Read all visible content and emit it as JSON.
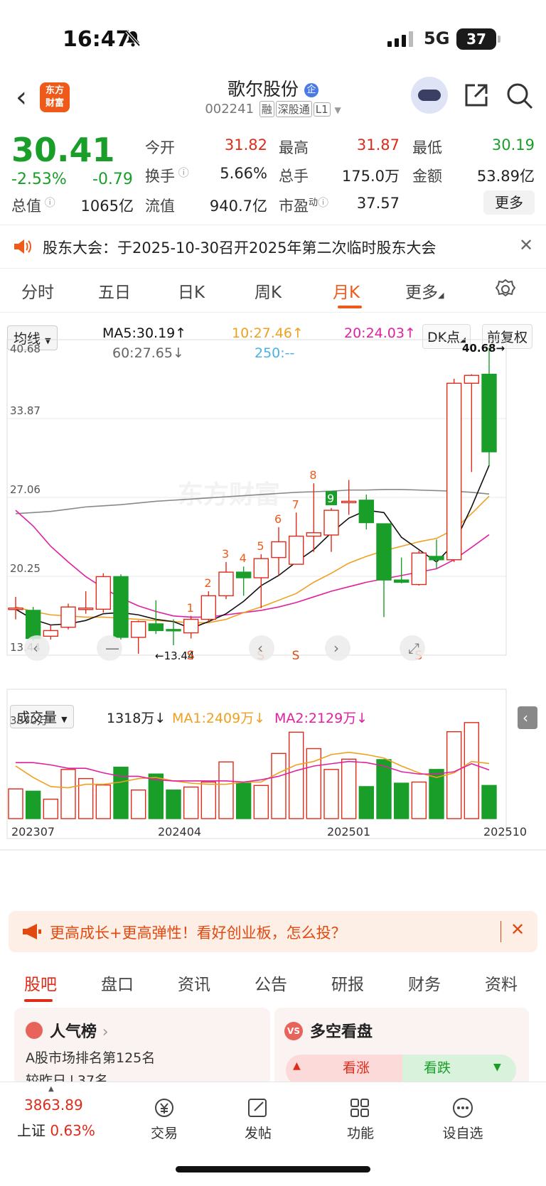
{
  "status_bar": {
    "time": "16:47",
    "network": "5G",
    "battery": "37"
  },
  "header": {
    "logo_text": "东方财富",
    "stock_name": "歌尔股份",
    "stock_code": "002241",
    "tags": [
      "融",
      "深股通",
      "L1"
    ]
  },
  "quote": {
    "price": "30.41",
    "change_pct": "-2.53%",
    "change_amt": "-0.79",
    "fields": [
      {
        "label": "今开",
        "value": "31.82",
        "color": "#e02a1a"
      },
      {
        "label": "最高",
        "value": "31.87",
        "color": "#e02a1a"
      },
      {
        "label": "最低",
        "value": "30.19",
        "color": "#1a9e2a"
      },
      {
        "label": "换手",
        "value": "5.66%",
        "color": "#222222"
      },
      {
        "label": "总手",
        "value": "175.0万",
        "color": "#222222"
      },
      {
        "label": "金额",
        "value": "53.89亿",
        "color": "#222222"
      },
      {
        "label": "总值",
        "value": "1065亿",
        "color": "#222222"
      },
      {
        "label": "流值",
        "value": "940.7亿",
        "color": "#222222"
      },
      {
        "label": "市盈",
        "value": "37.57",
        "color": "#222222"
      }
    ],
    "pe_sup": "动",
    "more_label": "更多"
  },
  "notice": {
    "text": "股东大会：于2025-10-30召开2025年第二次临时股东大会"
  },
  "kline_tabs": {
    "items": [
      "分时",
      "五日",
      "日K",
      "周K",
      "月K",
      "更多"
    ],
    "active": "月K"
  },
  "indicator": {
    "selector": "均线",
    "ma5": "MA5:30.19↑",
    "ma10": "10:27.46↑",
    "ma20": "20:24.03↑",
    "ma60": "60:27.65↓",
    "ma250": "250:--",
    "dk_label": "DK点",
    "adjust_label": "前复权"
  },
  "volume_panel": {
    "selector": "成交量",
    "vol": "1318万↓",
    "ma1": "MA1:2409万↓",
    "ma2": "MA2:2129万↓",
    "max_label": "3870万"
  },
  "colors": {
    "up": "#e02a1a",
    "down": "#1a9e2a",
    "ma5": "#111111",
    "ma10": "#f0a020",
    "ma20": "#e020a0",
    "ma60": "#888888",
    "accent": "#ef5a1a"
  },
  "chart_data": {
    "type": "candlestick",
    "period": "monthly",
    "yticks": [
      "40.68",
      "33.87",
      "27.06",
      "20.25",
      "13.44"
    ],
    "ylim": [
      13.44,
      40.68
    ],
    "xticks": [
      "202307",
      "202404",
      "202501",
      "202510"
    ],
    "high_marker": "40.68→",
    "low_marker": "←13.44",
    "td_counts": [
      "1",
      "2",
      "3",
      "4",
      "5",
      "6",
      "7",
      "8",
      "9"
    ],
    "s_markers": [
      "S",
      "S",
      "S",
      "S"
    ],
    "candles": [
      {
        "o": 17.5,
        "c": 17.5,
        "h": 18.5,
        "l": 16.5
      },
      {
        "o": 17.3,
        "c": 14.8,
        "h": 17.6,
        "l": 14.6
      },
      {
        "o": 15.0,
        "c": 15.5,
        "h": 16.0,
        "l": 14.7
      },
      {
        "o": 15.8,
        "c": 17.6,
        "h": 17.9,
        "l": 15.6
      },
      {
        "o": 17.4,
        "c": 17.5,
        "h": 19.0,
        "l": 17.0
      },
      {
        "o": 17.4,
        "c": 20.3,
        "h": 20.6,
        "l": 17.1
      },
      {
        "o": 20.3,
        "c": 14.9,
        "h": 20.5,
        "l": 14.7
      },
      {
        "o": 14.9,
        "c": 16.3,
        "h": 16.4,
        "l": 13.44
      },
      {
        "o": 16.1,
        "c": 15.5,
        "h": 18.2,
        "l": 15.2
      },
      {
        "o": 15.6,
        "c": 15.5,
        "h": 16.5,
        "l": 14.2
      },
      {
        "o": 15.3,
        "c": 16.5,
        "h": 16.8,
        "l": 14.8
      },
      {
        "o": 16.5,
        "c": 18.6,
        "h": 19.0,
        "l": 16.3
      },
      {
        "o": 18.6,
        "c": 20.7,
        "h": 21.6,
        "l": 18.3
      },
      {
        "o": 20.7,
        "c": 20.2,
        "h": 21.2,
        "l": 18.6
      },
      {
        "o": 20.2,
        "c": 21.9,
        "h": 22.3,
        "l": 17.5
      },
      {
        "o": 22.0,
        "c": 23.4,
        "h": 24.7,
        "l": 20.4
      },
      {
        "o": 21.4,
        "c": 23.9,
        "h": 26.0,
        "l": 21.4
      },
      {
        "o": 23.9,
        "c": 24.2,
        "h": 28.6,
        "l": 22.5
      },
      {
        "o": 24.0,
        "c": 26.2,
        "h": 26.4,
        "l": 22.5
      },
      {
        "o": 26.9,
        "c": 27.0,
        "h": 28.9,
        "l": 25.8
      },
      {
        "o": 27.1,
        "c": 25.1,
        "h": 27.6,
        "l": 24.5
      },
      {
        "o": 25.0,
        "c": 20.0,
        "h": 25.0,
        "l": 16.7
      },
      {
        "o": 20.0,
        "c": 19.8,
        "h": 22.0,
        "l": 19.7
      },
      {
        "o": 19.6,
        "c": 22.4,
        "h": 22.6,
        "l": 19.5
      },
      {
        "o": 22.1,
        "c": 21.8,
        "h": 23.6,
        "l": 21.0
      },
      {
        "o": 21.8,
        "c": 37.5,
        "h": 37.9,
        "l": 21.6
      },
      {
        "o": 37.5,
        "c": 38.2,
        "h": 38.3,
        "l": 29.6
      },
      {
        "o": 38.3,
        "c": 31.4,
        "h": 40.68,
        "l": 30.19
      }
    ],
    "volume_max": 3870,
    "volumes": [
      1300,
      1200,
      850,
      2150,
      1750,
      1470,
      2250,
      1250,
      1950,
      1250,
      1380,
      1600,
      2480,
      1550,
      1450,
      2850,
      3780,
      3060,
      2150,
      2600,
      1400,
      2580,
      1550,
      1600,
      2150,
      3800,
      4200,
      1450
    ],
    "ma5": [
      17.4,
      16.5,
      16.0,
      16.1,
      16.4,
      17.0,
      17.1,
      16.9,
      16.5,
      16.3,
      15.7,
      16.3,
      17.0,
      18.1,
      19.5,
      20.4,
      21.6,
      22.7,
      24.2,
      25.5,
      26.2,
      26.0,
      23.8,
      22.7,
      21.6,
      23.2,
      26.5,
      30.19
    ],
    "ma10": [
      17.6,
      17.2,
      16.9,
      16.8,
      16.7,
      16.7,
      16.6,
      16.5,
      16.4,
      16.3,
      16.2,
      16.2,
      16.5,
      17.1,
      17.6,
      18.2,
      18.8,
      19.8,
      20.6,
      21.5,
      22.1,
      22.6,
      23.0,
      23.4,
      23.7,
      24.5,
      25.9,
      27.46
    ],
    "ma20": [
      26.2,
      24.8,
      23.0,
      21.6,
      20.3,
      19.3,
      18.4,
      17.7,
      17.2,
      16.8,
      16.7,
      16.7,
      16.9,
      17.1,
      17.3,
      17.6,
      18.0,
      18.5,
      19.0,
      19.4,
      19.8,
      20.1,
      20.4,
      20.7,
      21.0,
      21.8,
      22.9,
      24.03
    ],
    "ma60": [
      25.9,
      26.0,
      26.1,
      26.3,
      26.5,
      26.6,
      26.7,
      26.85,
      27.0,
      27.1,
      27.2,
      27.3,
      27.4,
      27.5,
      27.6,
      27.7,
      27.8,
      27.85,
      27.9,
      28.0,
      28.0,
      28.05,
      28.05,
      28.0,
      27.95,
      27.9,
      27.8,
      27.65
    ],
    "vol_ma1": [
      2300,
      1800,
      1400,
      1350,
      1500,
      1500,
      1600,
      1750,
      1800,
      1650,
      1550,
      1500,
      1500,
      1600,
      1600,
      2000,
      2350,
      2500,
      2800,
      2900,
      2800,
      2650,
      2300,
      2000,
      1800,
      2000,
      2500,
      2409
    ],
    "vol_ma2": [
      2450,
      2450,
      2350,
      2200,
      2200,
      2000,
      1850,
      1850,
      1700,
      1650,
      1650,
      1650,
      1650,
      1600,
      1700,
      1850,
      2100,
      2300,
      2400,
      2500,
      2450,
      2300,
      2050,
      1950,
      1950,
      2050,
      2400,
      2129
    ]
  },
  "banner": {
    "text": "更高成长+更高弹性！看好创业板，怎么投？"
  },
  "bottom_tabs": {
    "items": [
      "股吧",
      "盘口",
      "资讯",
      "公告",
      "研报",
      "财务",
      "资料"
    ],
    "active": "股吧"
  },
  "cards": {
    "popularity_title": "人气榜",
    "popularity_text": "A股市场排名第125名",
    "popularity_sub": "较昨日↓37名",
    "vs_title": "多空看盘",
    "bull_label": "看涨",
    "bear_label": "看跌"
  },
  "bottom_nav": {
    "index_value": "3863.89",
    "index_name": "上证",
    "index_change": "0.63%",
    "items": [
      "交易",
      "发帖",
      "功能",
      "设自选"
    ]
  }
}
